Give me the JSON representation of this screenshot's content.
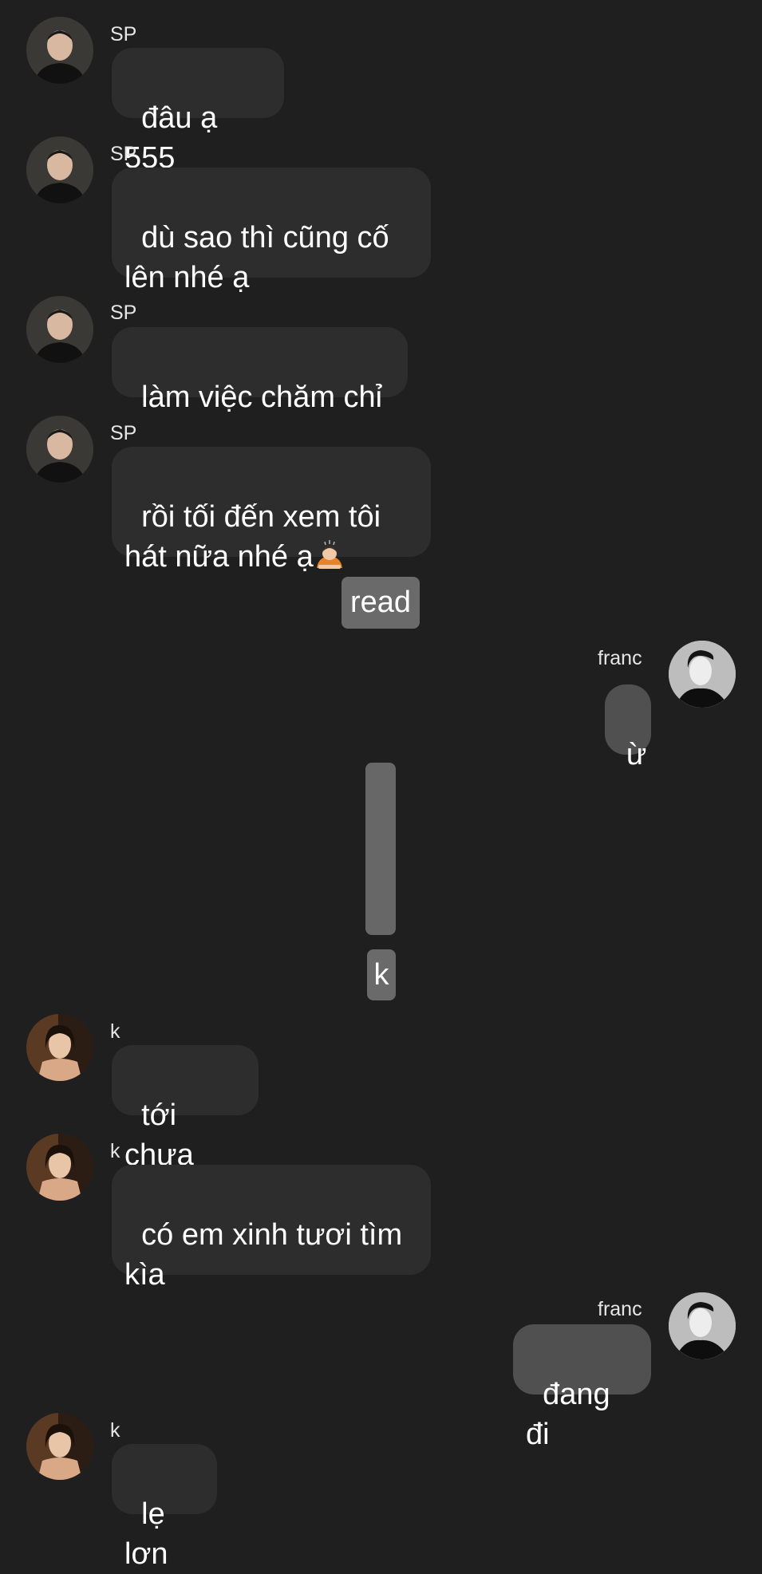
{
  "messages": [
    {
      "sender": "SP",
      "text": "đâu ạ 555"
    },
    {
      "sender": "SP",
      "text": "dù sao thì cũng cố\nlên nhé ạ"
    },
    {
      "sender": "SP",
      "text": "làm việc chăm chỉ"
    },
    {
      "sender": "SP",
      "text": "rồi tối đến xem tôi\nhát nữa nhé ạ"
    },
    {
      "system": "read"
    },
    {
      "sender": "franc",
      "text": "ừ"
    },
    {
      "system": "k"
    },
    {
      "sender": "k",
      "text": "tới chưa"
    },
    {
      "sender": "k",
      "text": "có em xinh tươi tìm\nkìa"
    },
    {
      "sender": "franc",
      "text": "đang đi"
    },
    {
      "sender": "k",
      "text": "lẹ lơn"
    }
  ],
  "icons": {
    "bowing-person-emoji": "🙇"
  },
  "colors": {
    "background": "#1f1f1f",
    "incoming_bubble": "#2d2d2d",
    "outgoing_bubble": "#505050",
    "tag": "#6a6a6a"
  }
}
